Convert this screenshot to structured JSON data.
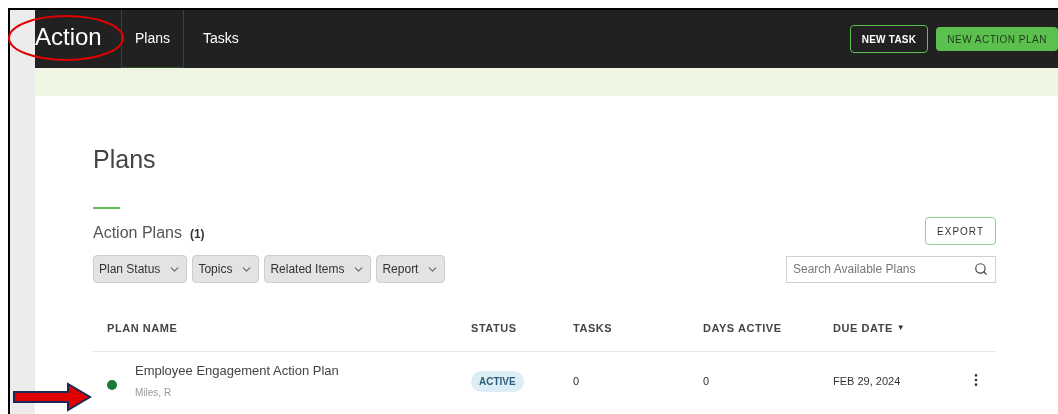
{
  "header": {
    "app_title": "Action",
    "tabs": [
      {
        "label": "Plans",
        "selected": true
      },
      {
        "label": "Tasks",
        "selected": false
      }
    ],
    "buttons": [
      {
        "label": "NEW TASK",
        "kind": "outline"
      },
      {
        "label": "NEW ACTION PLAN",
        "kind": "primary"
      }
    ]
  },
  "page_title": "Plans",
  "section": {
    "title": "Action Plans",
    "count": "(1)",
    "export_button": "EXPORT"
  },
  "filters": [
    "Plan Status",
    "Topics",
    "Related Items",
    "Report"
  ],
  "search": {
    "placeholder": "Search Available Plans"
  },
  "table": {
    "columns": [
      {
        "label": "PLAN NAME"
      },
      {
        "label": "STATUS"
      },
      {
        "label": "TASKS"
      },
      {
        "label": "DAYS ACTIVE"
      },
      {
        "label": "DUE DATE",
        "sort_indicator": "▼"
      }
    ],
    "rows": [
      {
        "name": "Employee Engagement Action Plan",
        "owner": "Miles, R",
        "color": "#1a7a3a",
        "status": "ACTIVE",
        "tasks": "0",
        "days_active": "0",
        "due_date": "FEB 29, 2024"
      }
    ]
  },
  "annotations": {
    "circle_on_title": true,
    "arrow_to_row": true
  }
}
